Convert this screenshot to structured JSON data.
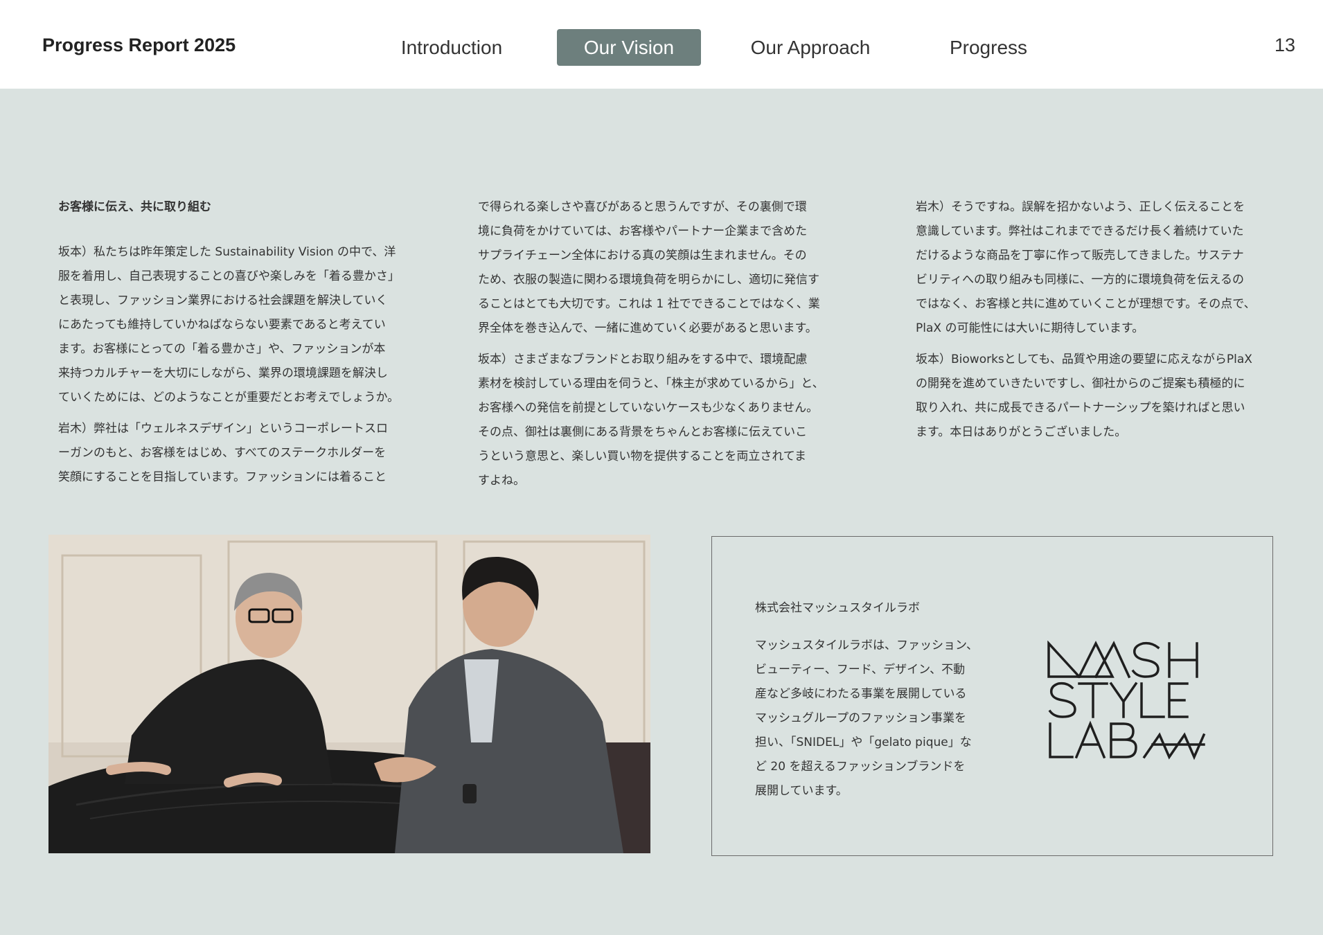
{
  "header": {
    "report_title": "Progress Report 2025",
    "nav": [
      "Introduction",
      "Our Vision",
      "Our Approach",
      "Progress"
    ],
    "active_nav": "Our Vision",
    "page_number": "13"
  },
  "columns": {
    "col1": {
      "heading": "お客様に伝え、共に取り組む",
      "p1": [
        "坂本）私たちは昨年策定した Sustainability Vision の中で、洋",
        "服を着用し、自己表現することの喜びや楽しみを「着る豊かさ」",
        "と表現し、ファッション業界における社会課題を解決していく",
        "にあたっても維持していかねばならない要素であると考えてい",
        "ます。お客様にとっての「着る豊かさ」や、ファッションが本",
        "来持つカルチャーを大切にしながら、業界の環境課題を解決し",
        "ていくためには、どのようなことが重要だとお考えでしょうか。"
      ],
      "p2": [
        "岩木）弊社は「ウェルネスデザイン」というコーポレートスロ",
        "ーガンのもと、お客様をはじめ、すべてのステークホルダーを",
        "笑顔にすることを目指しています。ファッションには着ること"
      ]
    },
    "col2": {
      "p1": [
        "で得られる楽しさや喜びがあると思うんですが、その裏側で環",
        "境に負荷をかけていては、お客様やパートナー企業まで含めた",
        "サプライチェーン全体における真の笑顔は生まれません。その",
        "ため、衣服の製造に関わる環境負荷を明らかにし、適切に発信す",
        "ることはとても大切です。これは 1 社でできることではなく、業",
        "界全体を巻き込んで、一緒に進めていく必要があると思います。"
      ],
      "p2": [
        "坂本）さまざまなブランドとお取り組みをする中で、環境配慮",
        "素材を検討している理由を伺うと、「株主が求めているから」と、",
        "お客様への発信を前提としていないケースも少なくありません。",
        "その点、御社は裏側にある背景をちゃんとお客様に伝えていこ",
        "うという意思と、楽しい買い物を提供することを両立されてま",
        "すよね。"
      ]
    },
    "col3": {
      "p1": [
        "岩木）そうですね。誤解を招かないよう、正しく伝えることを",
        "意識しています。弊社はこれまでできるだけ長く着続けていた",
        "だけるような商品を丁寧に作って販売してきました。サステナ",
        "ビリティへの取り組みも同様に、一方的に環境負荷を伝えるの",
        "ではなく、お客様と共に進めていくことが理想です。その点で、",
        "PlaX の可能性には大いに期待しています。"
      ],
      "p2": [
        "坂本）Bioworksとしても、品質や用途の要望に応えながらPlaX",
        "の開発を進めていきたいですし、御社からのご提案も積極的に",
        "取り入れ、共に成長できるパートナーシップを築ければと思い",
        "ます。本日はありがとうございました。"
      ]
    }
  },
  "company": {
    "name": "株式会社マッシュスタイルラボ",
    "description": [
      "マッシュスタイルラボは、ファッション、",
      "ビューティー、フード、デザイン、不動",
      "産など多岐にわたる事業を展開している",
      "マッシュグループのファッション事業を",
      "担い、「SNIDEL」や「gelato pique」な",
      "ど 20 を超えるファッションブランドを",
      "展開しています。"
    ],
    "logo_text": "MASH STYLE LAB"
  },
  "colors": {
    "page_bg": "#dae2e0",
    "header_bg": "#ffffff",
    "nav_active_bg": "#6d7f7d"
  }
}
